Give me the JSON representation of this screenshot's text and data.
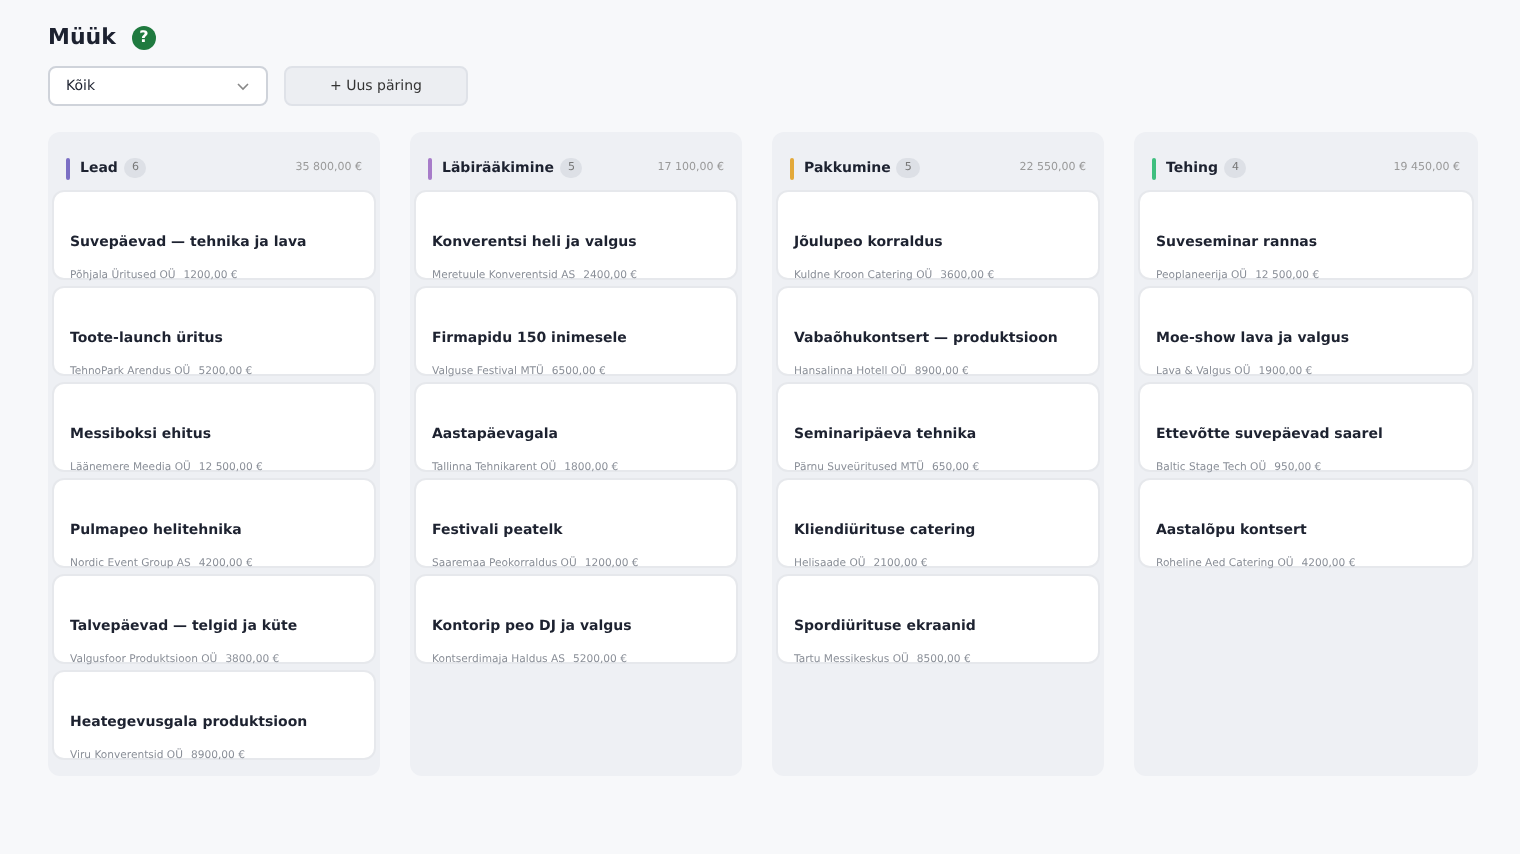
{
  "page": {
    "title": "Müük",
    "help_icon": "?"
  },
  "toolbar": {
    "filter": {
      "value": "Kõik"
    },
    "new_button": "+ Uus päring"
  },
  "columns": [
    {
      "name": "Lead",
      "count": "6",
      "total": "35 800,00 €",
      "color": "#7b6fc4",
      "cards": [
        {
          "title": "Suvepäevad — tehnika ja lava",
          "company": "Põhjala Üritused OÜ",
          "amount": "1200,00 €"
        },
        {
          "title": "Toote-launch üritus",
          "company": "TehnoPark Arendus OÜ",
          "amount": "5200,00 €"
        },
        {
          "title": "Messiboksi ehitus",
          "company": "Läänemere Meedia OÜ",
          "amount": "12 500,00 €"
        },
        {
          "title": "Pulmapeo helitehnika",
          "company": "Nordic Event Group AS",
          "amount": "4200,00 €"
        },
        {
          "title": "Talvepäevad — telgid ja küte",
          "company": "Valgusfoor Produktsioon OÜ",
          "amount": "3800,00 €"
        },
        {
          "title": "Heategevusgala produktsioon",
          "company": "Viru Konverentsid OÜ",
          "amount": "8900,00 €"
        }
      ]
    },
    {
      "name": "Läbirääkimine",
      "count": "5",
      "total": "17 100,00 €",
      "color": "#a77cc9",
      "cards": [
        {
          "title": "Konverentsi heli ja valgus",
          "company": "Meretuule Konverentsid AS",
          "amount": "2400,00 €"
        },
        {
          "title": "Firmapidu 150 inimesele",
          "company": "Valguse Festival MTÜ",
          "amount": "6500,00 €"
        },
        {
          "title": "Aastapäevagala",
          "company": "Tallinna Tehnikarent OÜ",
          "amount": "1800,00 €"
        },
        {
          "title": "Festivali peatelk",
          "company": "Saaremaa Peokorraldus OÜ",
          "amount": "1200,00 €"
        },
        {
          "title": "Kontorip peo DJ ja valgus",
          "company": "Kontserdimaja Haldus AS",
          "amount": "5200,00 €"
        }
      ]
    },
    {
      "name": "Pakkumine",
      "count": "5",
      "total": "22 550,00 €",
      "color": "#e3a93a",
      "cards": [
        {
          "title": "Jõulupeo korraldus",
          "company": "Kuldne Kroon Catering OÜ",
          "amount": "3600,00 €"
        },
        {
          "title": "Vabaõhukontsert — produktsioon",
          "company": "Hansalinna Hotell OÜ",
          "amount": "8900,00 €"
        },
        {
          "title": "Seminaripäeva tehnika",
          "company": "Pärnu Suveüritused MTÜ",
          "amount": "650,00 €"
        },
        {
          "title": "Kliendiürituse catering",
          "company": "Helisaade OÜ",
          "amount": "2100,00 €"
        },
        {
          "title": "Spordiürituse ekraanid",
          "company": "Tartu Messikeskus OÜ",
          "amount": "8500,00 €"
        }
      ]
    },
    {
      "name": "Tehing",
      "count": "4",
      "total": "19 450,00 €",
      "color": "#3fbf7f",
      "cards": [
        {
          "title": "Suveseminar rannas",
          "company": "Peoplaneerija OÜ",
          "amount": "12 500,00 €"
        },
        {
          "title": "Moe-show lava ja valgus",
          "company": "Lava & Valgus OÜ",
          "amount": "1900,00 €"
        },
        {
          "title": "Ettevõtte suvepäevad saarel",
          "company": "Baltic Stage Tech OÜ",
          "amount": "950,00 €"
        },
        {
          "title": "Aastalõpu kontsert",
          "company": "Roheline Aed Catering OÜ",
          "amount": "4200,00 €"
        }
      ]
    }
  ]
}
